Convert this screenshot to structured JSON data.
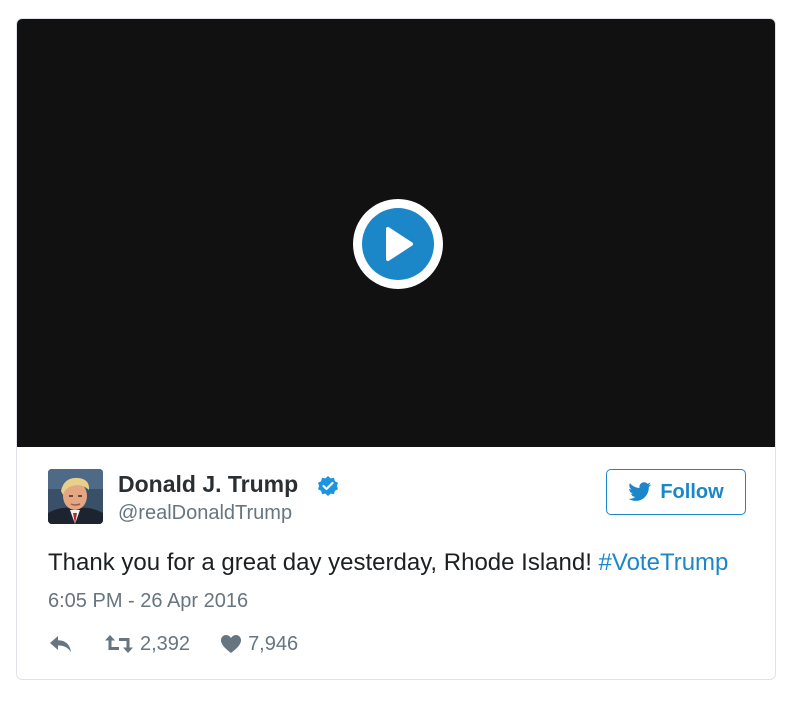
{
  "tweet": {
    "author": {
      "name": "Donald J. Trump",
      "handle": "@realDonaldTrump",
      "verified": true
    },
    "follow_label": "Follow",
    "text_main": "Thank you for a great day yesterday, Rhode Island! ",
    "hashtag": "#VoteTrump",
    "timestamp": "6:05 PM - 26 Apr 2016",
    "retweets": "2,392",
    "likes": "7,946"
  },
  "icons": {
    "play": "play-icon",
    "verified": "verified-badge-icon",
    "follow": "twitter-bird-icon",
    "reply": "reply-icon",
    "retweet": "retweet-icon",
    "like": "heart-icon"
  },
  "colors": {
    "accent": "#1b87c9",
    "video_background": "#111111",
    "secondary_text": "#66757f",
    "primary_text": "#1c2022",
    "border": "#dfe3e8"
  }
}
